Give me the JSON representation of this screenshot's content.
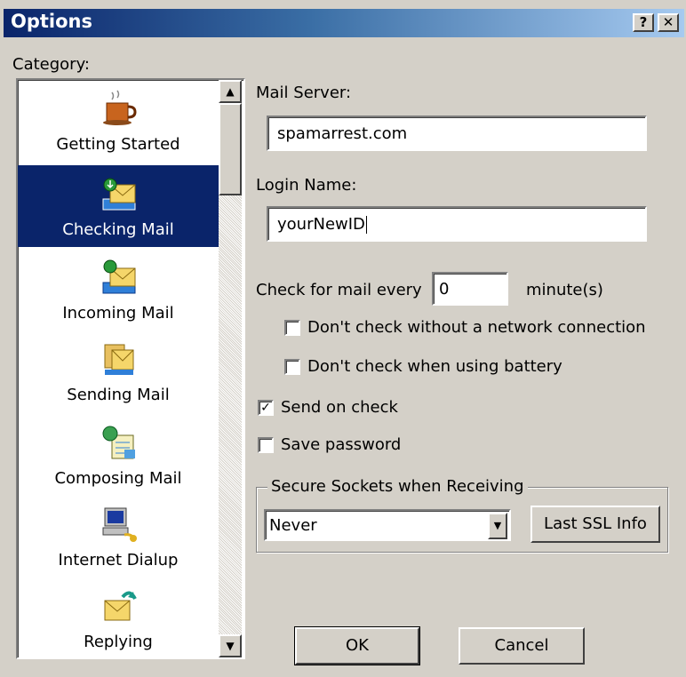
{
  "window": {
    "title": "Options",
    "help_label": "?",
    "close_label": "✕"
  },
  "category": {
    "label": "Category:",
    "items": [
      {
        "label": "Getting Started",
        "icon": "coffee-cup-icon",
        "selected": false
      },
      {
        "label": "Checking Mail",
        "icon": "mail-download-icon",
        "selected": true
      },
      {
        "label": "Incoming Mail",
        "icon": "mail-inbox-icon",
        "selected": false
      },
      {
        "label": "Sending Mail",
        "icon": "mail-send-icon",
        "selected": false
      },
      {
        "label": "Composing Mail",
        "icon": "compose-icon",
        "selected": false
      },
      {
        "label": "Internet Dialup",
        "icon": "dialup-computer-icon",
        "selected": false
      },
      {
        "label": "Replying",
        "icon": "reply-mail-icon",
        "selected": false
      }
    ]
  },
  "form": {
    "mail_server_label": "Mail Server:",
    "mail_server_value": "spamarrest.com",
    "login_name_label": "Login Name:",
    "login_name_value": "yourNewID",
    "check_every_label": "Check for mail every",
    "check_every_value": "0",
    "minutes_label": "minute(s)",
    "no_network_label": "Don't check without a network connection",
    "no_network_checked": false,
    "no_battery_label": "Don't check when using battery",
    "no_battery_checked": false,
    "send_on_check_label": "Send on check",
    "send_on_check_checked": true,
    "save_password_label": "Save password",
    "save_password_checked": false
  },
  "ssl": {
    "group_label": "Secure Sockets when Receiving",
    "selected": "Never",
    "info_button": "Last SSL Info"
  },
  "buttons": {
    "ok": "OK",
    "cancel": "Cancel"
  },
  "colors": {
    "face": "#d4d0c8",
    "selection": "#0a246a",
    "title_start": "#0a246a",
    "title_end": "#a6caf0"
  }
}
